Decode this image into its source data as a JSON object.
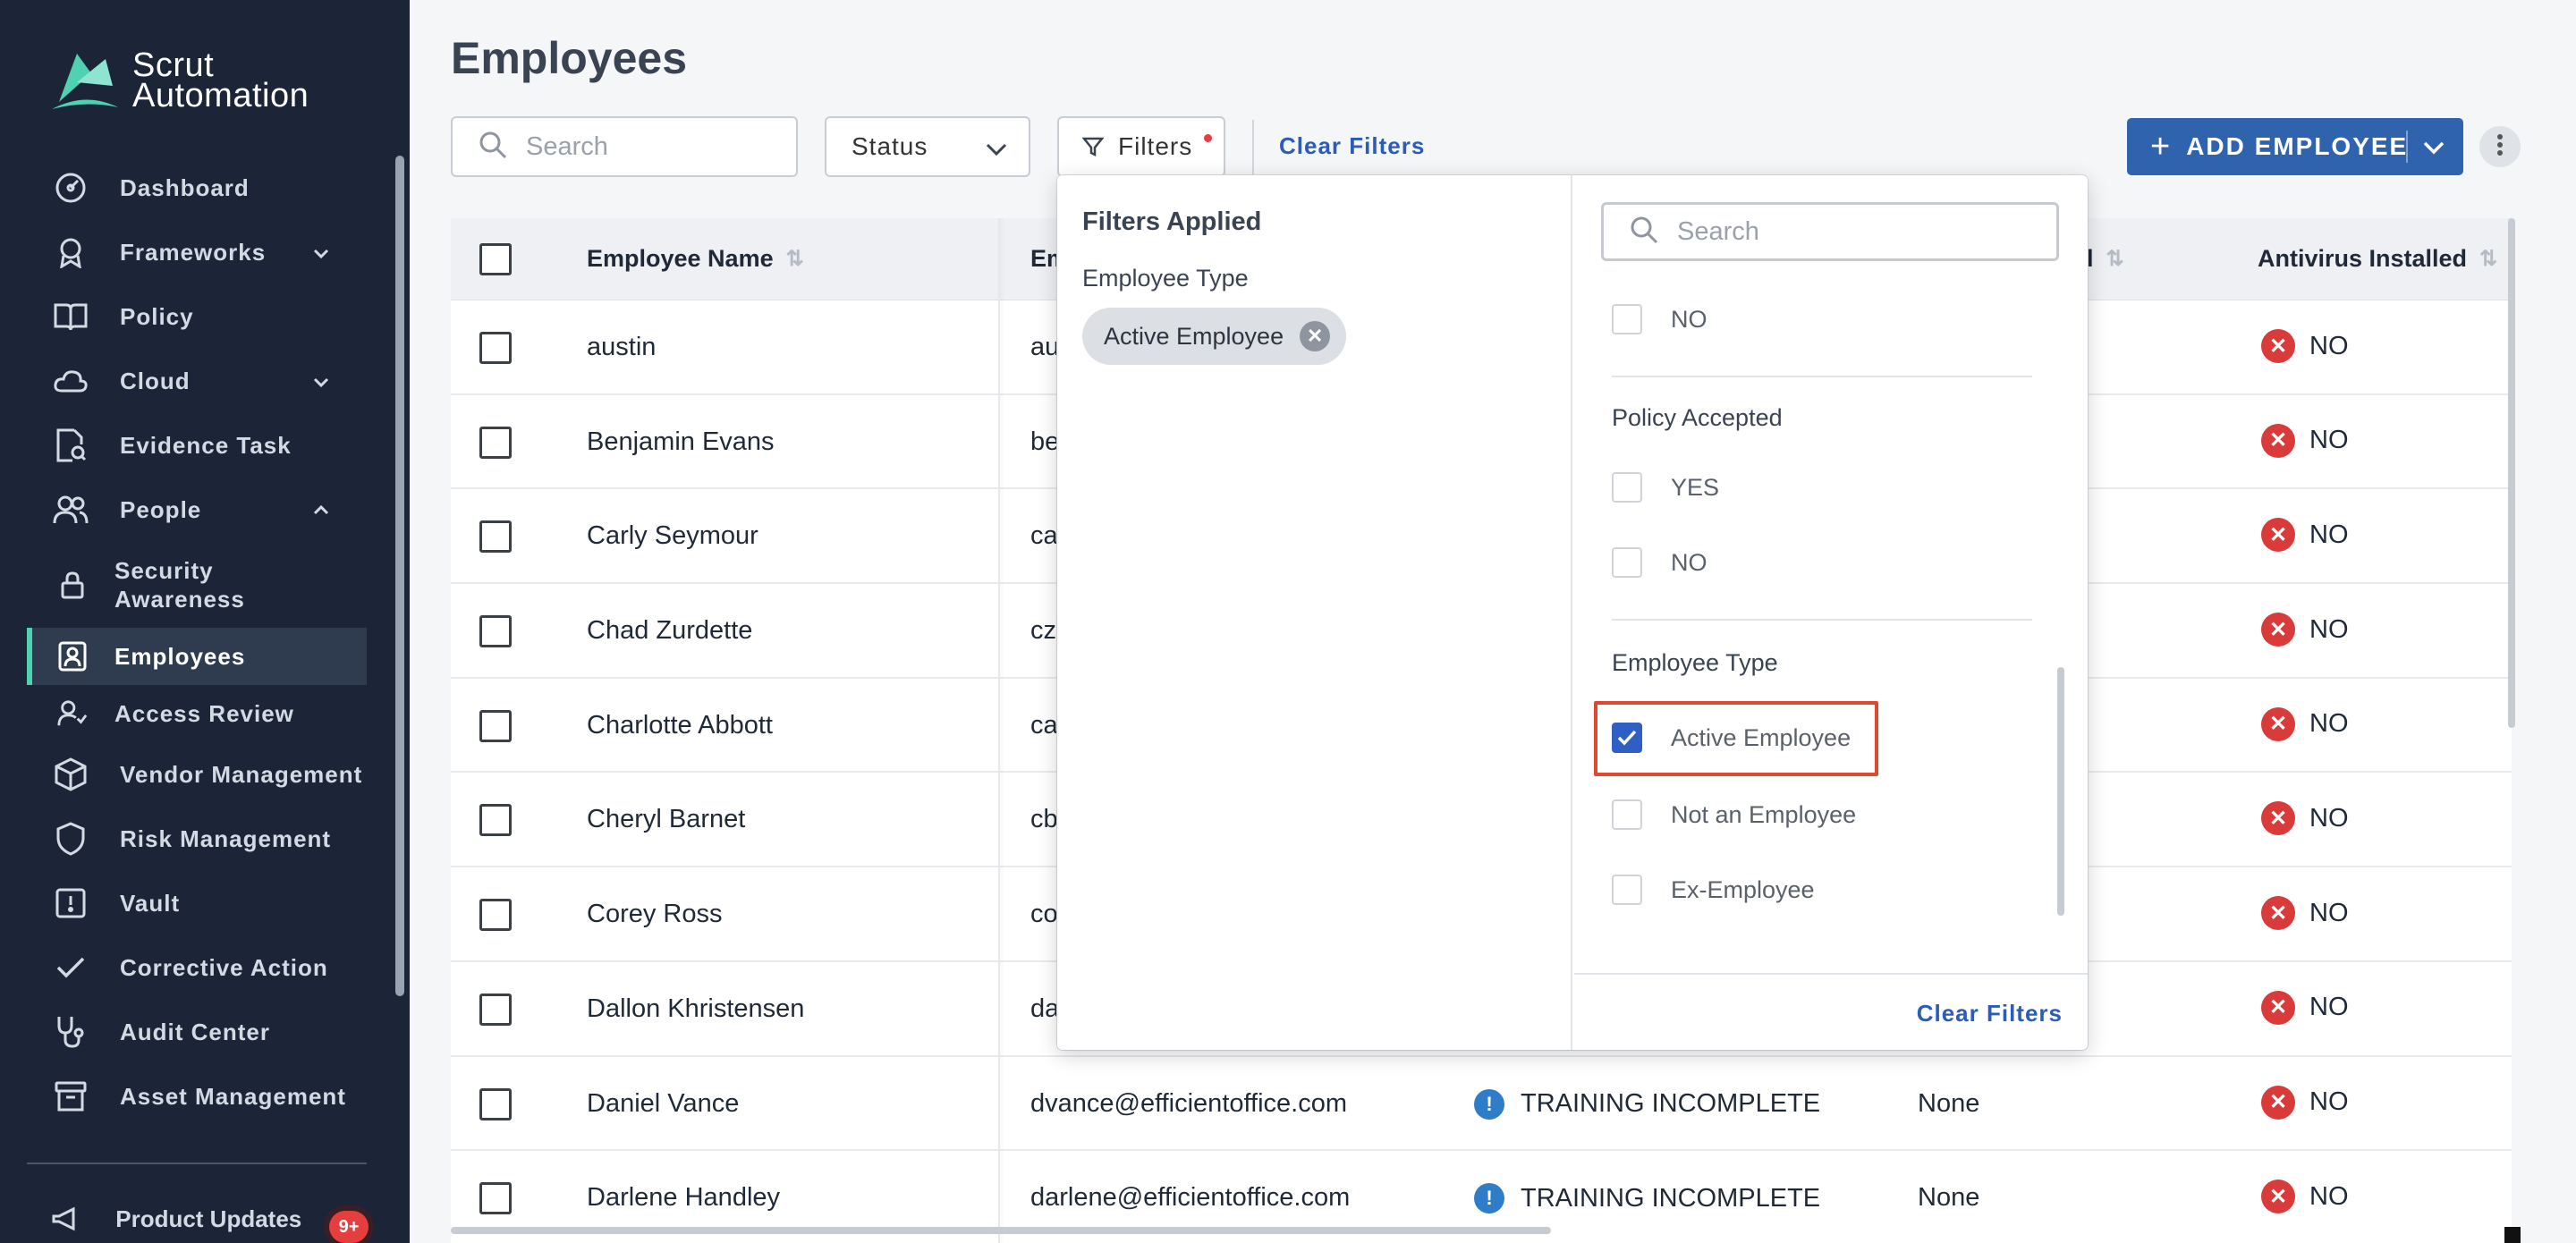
{
  "brand": {
    "line1": "Scrut",
    "line2": "Automation"
  },
  "sidebar": {
    "items": [
      {
        "label": "Dashboard",
        "icon": "dashboard-icon"
      },
      {
        "label": "Frameworks",
        "icon": "award-icon",
        "expandable": true
      },
      {
        "label": "Policy",
        "icon": "book-icon"
      },
      {
        "label": "Cloud",
        "icon": "cloud-icon",
        "expandable": true
      },
      {
        "label": "Evidence Task",
        "icon": "file-search-icon"
      },
      {
        "label": "People",
        "icon": "users-icon",
        "expanded": true
      },
      {
        "label": "Security Awareness",
        "icon": "lock-icon"
      },
      {
        "label": "Employees",
        "icon": "employee-badge-icon",
        "active": true
      },
      {
        "label": "Access Review",
        "icon": "user-check-icon"
      },
      {
        "label": "Vendor Management",
        "icon": "box-icon"
      },
      {
        "label": "Risk Management",
        "icon": "shield-icon"
      },
      {
        "label": "Vault",
        "icon": "vault-icon"
      },
      {
        "label": "Corrective Action",
        "icon": "check-icon"
      },
      {
        "label": "Audit Center",
        "icon": "stethoscope-icon"
      },
      {
        "label": "Asset Management",
        "icon": "archive-icon"
      }
    ],
    "bottom_item": "Product Updates",
    "badge": "9+"
  },
  "header": {
    "title": "Employees",
    "search_placeholder": "Search",
    "status_label": "Status",
    "filters_label": "Filters",
    "clear_filters": "Clear Filters",
    "add_employee": "ADD EMPLOYEE"
  },
  "table": {
    "columns": {
      "name": "Employee Name",
      "email": "Em",
      "policy": "d",
      "antivirus": "Antivirus Installed"
    },
    "rows": [
      {
        "name": "austin",
        "email": "au",
        "training": "",
        "policy": "",
        "antivirus": "NO"
      },
      {
        "name": "Benjamin Evans",
        "email": "be",
        "training": "",
        "policy": "",
        "antivirus": "NO"
      },
      {
        "name": "Carly Seymour",
        "email": "ca",
        "training": "",
        "policy": "",
        "antivirus": "NO"
      },
      {
        "name": "Chad Zurdette",
        "email": "czu",
        "training": "",
        "policy": "",
        "antivirus": "NO"
      },
      {
        "name": "Charlotte Abbott",
        "email": "ca",
        "training": "",
        "policy": "",
        "antivirus": "NO"
      },
      {
        "name": "Cheryl Barnet",
        "email": "cb",
        "training": "",
        "policy": "",
        "antivirus": "NO"
      },
      {
        "name": "Corey Ross",
        "email": "co",
        "training": "",
        "policy": "",
        "antivirus": "NO"
      },
      {
        "name": "Dallon Khristensen",
        "email": "da",
        "training": "",
        "policy": "",
        "antivirus": "NO"
      },
      {
        "name": "Daniel Vance",
        "email": "dvance@efficientoffice.com",
        "training": "TRAINING INCOMPLETE",
        "policy": "None",
        "antivirus": "NO"
      },
      {
        "name": "Darlene Handley",
        "email": "darlene@efficientoffice.com",
        "training": "TRAINING INCOMPLETE",
        "policy": "None",
        "antivirus": "NO"
      }
    ]
  },
  "filter_popup": {
    "applied_title": "Filters Applied",
    "applied_group": "Employee Type",
    "applied_chip": "Active Employee",
    "search_placeholder": "Search",
    "top_option": "NO",
    "policy_group": "Policy Accepted",
    "policy_yes": "YES",
    "policy_no": "NO",
    "type_group": "Employee Type",
    "type_active": "Active Employee",
    "type_not": "Not an Employee",
    "type_ex": "Ex-Employee",
    "clear_filters": "Clear Filters"
  },
  "colors": {
    "sidebar_bg": "#1b2537",
    "accent": "#4fd1b2",
    "primary": "#2f63ad",
    "link": "#2b5cb8",
    "danger": "#d93b3b",
    "highlight": "#e0472f"
  }
}
